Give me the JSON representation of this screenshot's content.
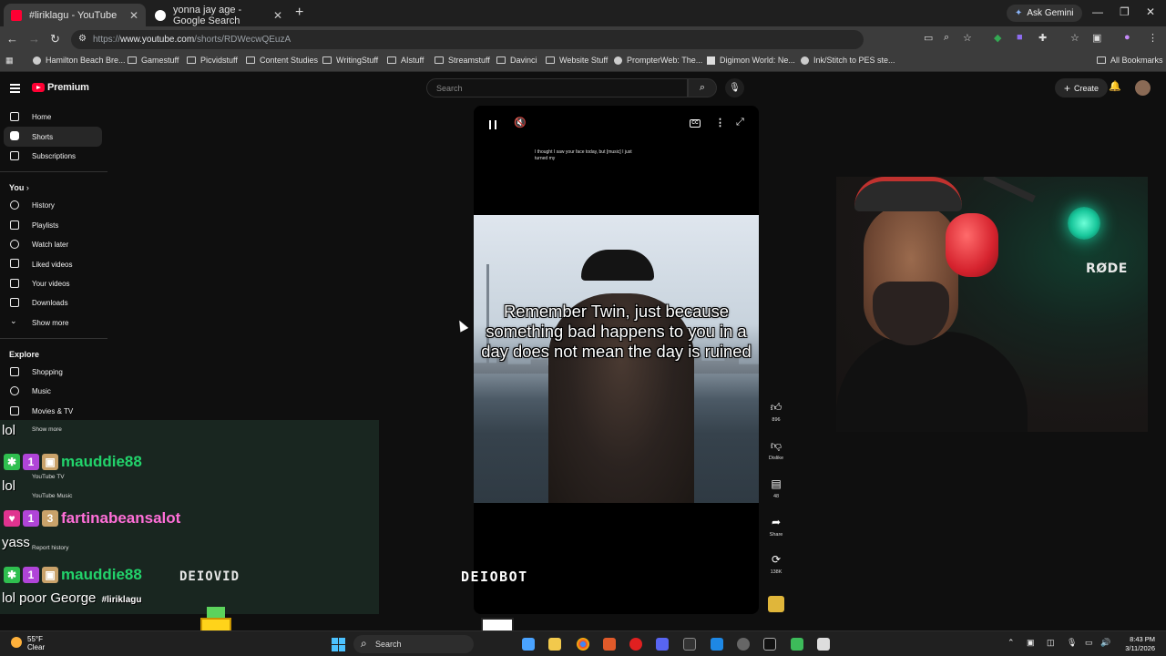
{
  "browser": {
    "tabs": [
      {
        "title": "#liriklagu - YouTube"
      },
      {
        "title": "yonna jay age - Google Search"
      }
    ],
    "new_tab": "+",
    "ask_gemini": "Ask Gemini",
    "url_prefix": "https://",
    "url_host": "www.youtube.com",
    "url_path": "/shorts/RDWecwQEuzA",
    "bookmarks": [
      {
        "label": "Hamilton Beach Bre...",
        "type": "site"
      },
      {
        "label": "Gamestuff",
        "type": "folder"
      },
      {
        "label": "Picvidstuff",
        "type": "folder"
      },
      {
        "label": "Content Studies",
        "type": "folder"
      },
      {
        "label": "WritingStuff",
        "type": "folder"
      },
      {
        "label": "AIstuff",
        "type": "folder"
      },
      {
        "label": "Streamstuff",
        "type": "folder"
      },
      {
        "label": "Davinci",
        "type": "folder"
      },
      {
        "label": "Website Stuff",
        "type": "folder"
      },
      {
        "label": "PrompterWeb: The...",
        "type": "site"
      },
      {
        "label": "Digimon World: Ne...",
        "type": "site"
      },
      {
        "label": "Ink/Stitch to PES ste...",
        "type": "site"
      }
    ],
    "all_bookmarks": "All Bookmarks"
  },
  "youtube": {
    "logo_text": "Premium",
    "search_placeholder": "Search",
    "create_label": "Create",
    "sidebar": {
      "main": [
        {
          "label": "Home",
          "icon": "home-icon"
        },
        {
          "label": "Shorts",
          "icon": "shorts-icon",
          "selected": true
        },
        {
          "label": "Subscriptions",
          "icon": "subscriptions-icon"
        }
      ],
      "you_header": "You",
      "you": [
        {
          "label": "History",
          "icon": "history-icon"
        },
        {
          "label": "Playlists",
          "icon": "playlists-icon"
        },
        {
          "label": "Watch later",
          "icon": "watch-later-icon"
        },
        {
          "label": "Liked videos",
          "icon": "liked-icon"
        },
        {
          "label": "Your videos",
          "icon": "your-videos-icon"
        },
        {
          "label": "Downloads",
          "icon": "downloads-icon"
        },
        {
          "label": "Show more",
          "icon": "chevron-down-icon"
        }
      ],
      "explore_header": "Explore",
      "explore": [
        {
          "label": "Shopping",
          "icon": "shopping-icon"
        },
        {
          "label": "Music",
          "icon": "music-icon"
        },
        {
          "label": "Movies & TV",
          "icon": "movies-icon"
        }
      ],
      "ghost_items": [
        {
          "label": "Show more"
        },
        {
          "label": "YouTube TV"
        },
        {
          "label": "YouTube Music"
        },
        {
          "label": "Report history"
        }
      ]
    },
    "short": {
      "small_caption": "I thought I saw your face today, but [music] I just turned my",
      "main_caption": "Remember Twin, just because something bad happens to you in a day does not mean the day is ruined",
      "likes": "896",
      "dislike_label": "Dislike",
      "comments": "48",
      "share_label": "Share",
      "remix_count": "138K",
      "cc_text": "CC"
    }
  },
  "webcam": {
    "mic_brand": "RØDE"
  },
  "chat": {
    "messages": [
      {
        "prefix_text": "lol",
        "user": "mauddie88",
        "user_color": "#22d36b",
        "badge_color": "#2fbf4f",
        "badge_glyph": "✱"
      },
      {
        "prefix_text": "lol",
        "user": "fartinabeansalot",
        "user_color": "#ff6fd8",
        "badge_color": "#e0338f",
        "badge_glyph": "♥"
      },
      {
        "prefix_text": "yass",
        "user": "mauddie88",
        "user_color": "#22d36b",
        "badge_color": "#2fbf4f",
        "badge_glyph": "✱"
      }
    ],
    "last_text": "lol poor George",
    "hashtag": "#liriklagu"
  },
  "overlays": {
    "deiovid": "DEIOVID",
    "deiobot": "DEIOBOT"
  },
  "taskbar": {
    "weather_temp": "55°F",
    "weather_desc": "Clear",
    "search_label": "Search",
    "time": "8:43 PM",
    "date": "3/11/2026"
  }
}
